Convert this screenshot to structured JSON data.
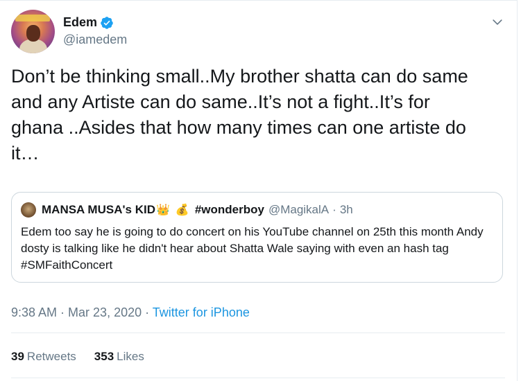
{
  "author": {
    "display_name": "Edem",
    "handle": "@iamedem",
    "verified": true
  },
  "tweet": {
    "text": "Don’t be thinking small..My brother shatta can do same\nand any Artiste can do same..It’s not a fight..It’s for\nghana ..Asides that how many times can one artiste do\nit…"
  },
  "quote": {
    "name_part1": "MANSA MUSA's KID",
    "crown": "👑",
    "moneybag": "💰",
    "name_part2": "#wonderboy",
    "handle": "@MagikalA",
    "separator": "·",
    "time": "3h",
    "text": "Edem too say he is going to do concert on his YouTube channel on 25th this month Andy dosty is talking like he didn't hear about Shatta Wale saying with even an hash tag #SMFaithConcert"
  },
  "meta": {
    "time": "9:38 AM",
    "dot1": " · ",
    "date": "Mar 23, 2020",
    "dot2": " · ",
    "source": "Twitter for iPhone"
  },
  "stats": {
    "retweets_count": "39",
    "retweets_label": "Retweets",
    "likes_count": "353",
    "likes_label": "Likes"
  },
  "icons": {
    "verified": "verified-badge-icon",
    "caret": "chevron-down-icon"
  },
  "colors": {
    "link": "#1b95e0",
    "muted": "#657786",
    "text": "#14171a",
    "border": "#ccd6dd"
  }
}
